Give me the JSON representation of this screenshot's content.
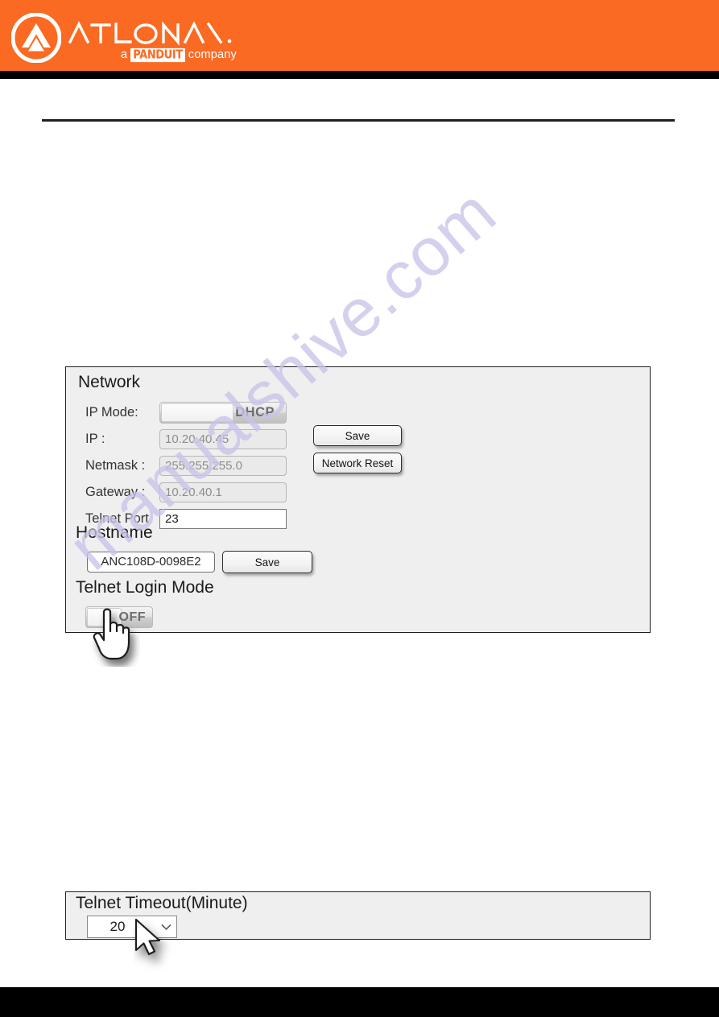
{
  "header": {
    "brand_name": "ATLONA",
    "brand_tagline_prefix": "a",
    "brand_tagline_company": "PANDUIT",
    "brand_tagline_suffix": "company",
    "orange_hex": "#fa6a22",
    "black_hex": "#000000"
  },
  "watermark": {
    "text": "manualshive.com",
    "color_hex": "#c9c3e8"
  },
  "network_panel": {
    "title": "Network",
    "rows": [
      {
        "label": "IP Mode:",
        "value": "DHCP",
        "type": "toggle"
      },
      {
        "label": "IP :",
        "value": "10.20.40.45",
        "type": "readonly"
      },
      {
        "label": "Netmask :",
        "value": "255.255.255.0",
        "type": "readonly"
      },
      {
        "label": "Gateway :",
        "value": "10.20.40.1",
        "type": "readonly"
      },
      {
        "label": "Telnet Port",
        "value": "23",
        "type": "editable"
      }
    ],
    "save_label": "Save",
    "network_reset_label": "Network Reset",
    "hostname_title": "Hostname",
    "hostname_value": "ANC108D-0098E2",
    "hostname_save_label": "Save",
    "telnet_login_title": "Telnet Login Mode",
    "telnet_login_state": "OFF"
  },
  "timeout_panel": {
    "title": "Telnet Timeout(Minute)",
    "selected_value": "20",
    "chevron": "⌄"
  },
  "icons": {
    "hand_cursor": "hand-pointer-cursor",
    "arrow_cursor": "arrow-cursor",
    "chevron_down": "chevron-down-icon",
    "atlona_logo": "atlona-logo-icon"
  }
}
